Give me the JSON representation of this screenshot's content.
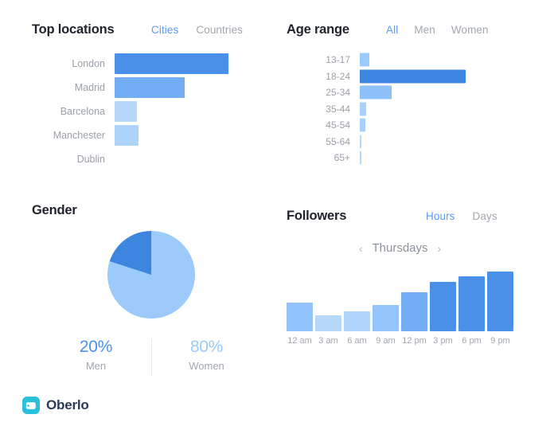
{
  "theme": {
    "accent": "#5b9bf3",
    "blue_dark": "#3d86e0",
    "blue_mid": "#4a90e8",
    "blue_light": "#73aef5",
    "blue_lighter": "#9ccafb",
    "blue_palest": "#b8d8fa",
    "muted_text": "#a2a7ae",
    "title_text": "#20242c",
    "logo_bg": "#28c0da",
    "logo_text_color": "#2b3a55"
  },
  "locations": {
    "title": "Top locations",
    "tabs": [
      {
        "label": "Cities",
        "active": true
      },
      {
        "label": "Countries",
        "active": false
      }
    ]
  },
  "age": {
    "title": "Age range",
    "tabs": [
      {
        "label": "All",
        "active": true
      },
      {
        "label": "Men",
        "active": false
      },
      {
        "label": "Women",
        "active": false
      }
    ]
  },
  "gender": {
    "title": "Gender",
    "stats": [
      {
        "pct": "20%",
        "label": "Men",
        "color": "#4a90e8"
      },
      {
        "pct": "80%",
        "label": "Women",
        "color": "#9ccafb"
      }
    ]
  },
  "followers": {
    "title": "Followers",
    "tabs": [
      {
        "label": "Hours",
        "active": true
      },
      {
        "label": "Days",
        "active": false
      }
    ],
    "prev_arrow": "‹",
    "next_arrow": "›",
    "current_day": "Thursdays"
  },
  "logo": {
    "name": "Oberlo",
    "icon": "oberlo-tag-icon"
  },
  "chart_data": [
    {
      "type": "bar",
      "orientation": "horizontal",
      "title": "Top locations",
      "xlabel": "",
      "ylabel": "",
      "categories": [
        "London",
        "Madrid",
        "Barcelona",
        "Manchester",
        "Dublin"
      ],
      "values": [
        100,
        61.5,
        19.6,
        21,
        0
      ],
      "xlim": [
        0,
        100
      ],
      "grid": false,
      "legend": "none",
      "colors": [
        "#4a90e8",
        "#73aef5",
        "#b8d8fa",
        "#aed3fb",
        "#ffffff"
      ]
    },
    {
      "type": "bar",
      "orientation": "horizontal",
      "title": "Age range",
      "xlabel": "",
      "ylabel": "",
      "categories": [
        "13-17",
        "18-24",
        "25-34",
        "35-44",
        "45-54",
        "55-64",
        "65+"
      ],
      "values": [
        9,
        100,
        30,
        6,
        5.5,
        1.2,
        1.2
      ],
      "xlim": [
        0,
        100
      ],
      "grid": false,
      "legend": "none",
      "colors": [
        "#9ccafb",
        "#3d86e0",
        "#8ec0fa",
        "#a8d0fb",
        "#a8d0fb",
        "#b8d8fa",
        "#b8d8fa"
      ]
    },
    {
      "type": "pie",
      "title": "Gender",
      "labels": [
        "Men",
        "Women"
      ],
      "values": [
        20,
        80
      ],
      "colors": [
        "#3d86e0",
        "#9ccafb"
      ],
      "legend": "below",
      "start_angle_deg": 0,
      "direction": "counter-clockwise"
    },
    {
      "type": "bar",
      "orientation": "vertical",
      "title": "Followers",
      "subtitle": "Thursdays",
      "xlabel": "",
      "ylabel": "",
      "categories": [
        "12 am",
        "3 am",
        "6 am",
        "9 am",
        "12 pm",
        "3 pm",
        "6 pm",
        "9 pm"
      ],
      "values": [
        46,
        26,
        32,
        42,
        63,
        80,
        88,
        96
      ],
      "ylim": [
        0,
        100
      ],
      "grid": false,
      "legend": "none",
      "colors": [
        "#92c3fa",
        "#b8d8fa",
        "#b0d4fb",
        "#94c4fa",
        "#73aef5",
        "#4a90e8",
        "#4a90e8",
        "#4a90e8"
      ]
    }
  ]
}
